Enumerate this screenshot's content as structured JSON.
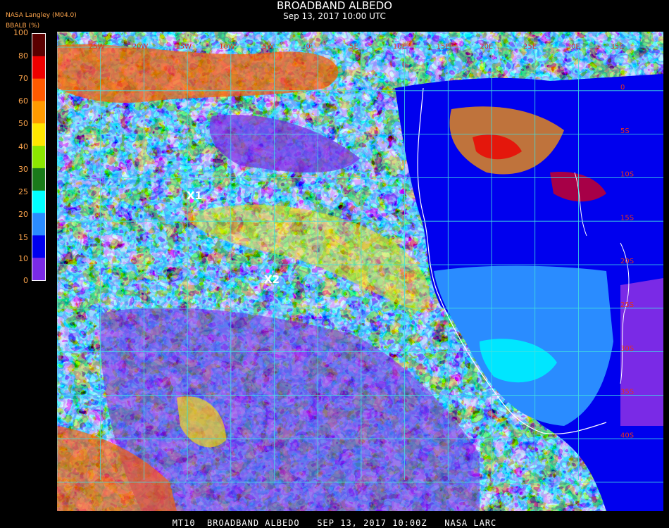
{
  "header": {
    "title": "BROADBAND ALBEDO",
    "subtitle": "Sep 13, 2017 10:00 UTC",
    "org_label": "NASA Langley (M04.0)",
    "product_label": "BBALB (%)"
  },
  "colorbar": {
    "ticks": [
      "100",
      "80",
      "70",
      "60",
      "50",
      "40",
      "30",
      "25",
      "20",
      "15",
      "10",
      "0"
    ],
    "colors": [
      "#5a0000",
      "#ee0000",
      "#ff5a00",
      "#ff9a00",
      "#ffe600",
      "#8ce600",
      "#1a7a1a",
      "#00ffff",
      "#2a8cff",
      "#0000ee",
      "#7a2ae6"
    ]
  },
  "map": {
    "markers": [
      {
        "label": "X1",
        "color": "#ff33ff"
      },
      {
        "label": "X2",
        "color": "#ff33ff"
      }
    ],
    "lon_labels": [
      "25W",
      "20W",
      "15W",
      "10W",
      "5W",
      "0",
      "5E",
      "10E",
      "15E",
      "20E",
      "25E",
      "30E",
      "35E"
    ],
    "lat_labels": [
      "0",
      "5S",
      "10S",
      "15S",
      "20S",
      "25S",
      "30S",
      "35S",
      "40S"
    ],
    "grid_color": "#40e0e0"
  },
  "footer": {
    "text": "MT10  BROADBAND ALBEDO   SEP 13, 2017 10:00Z   NASA LARC"
  }
}
